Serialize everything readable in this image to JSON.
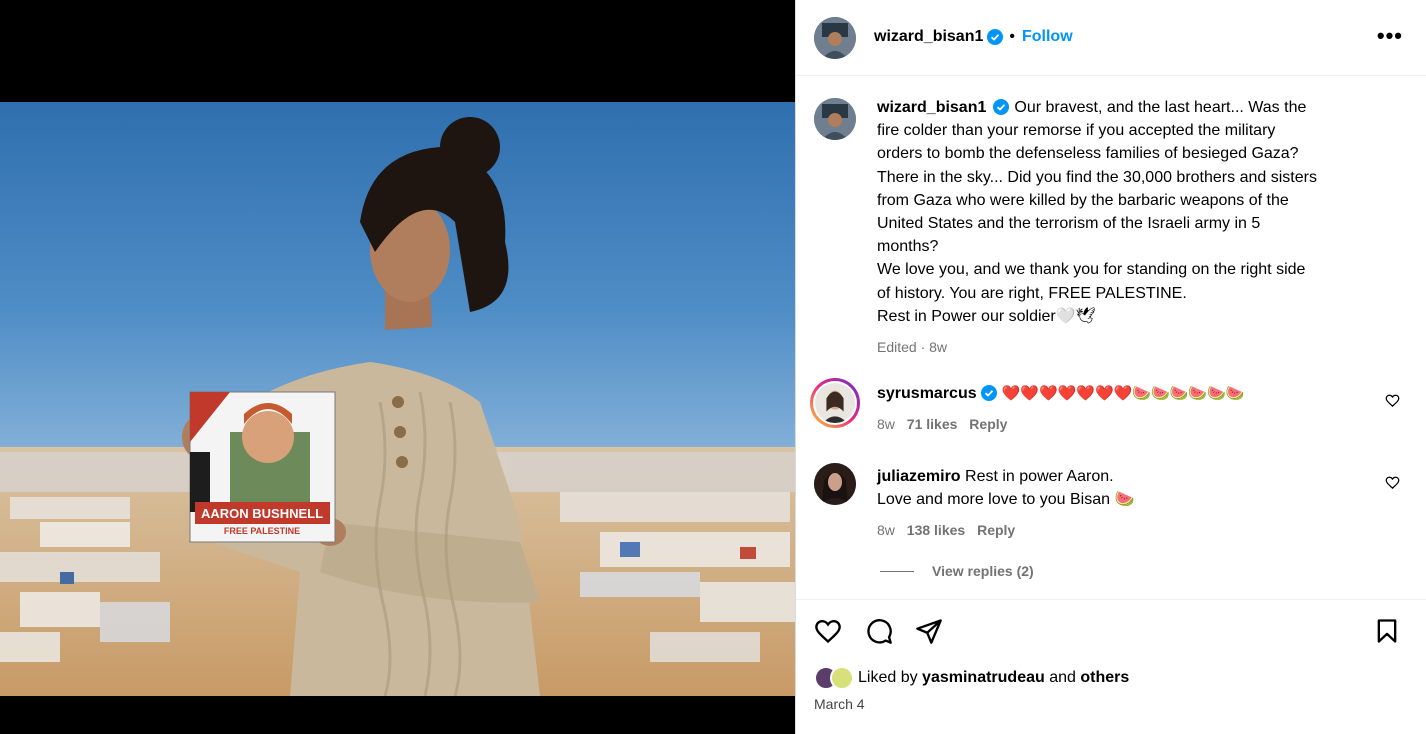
{
  "post": {
    "image": {
      "sign_line1": "AARON BUSHNELL",
      "sign_line2": "FREE PALESTINE"
    }
  },
  "header": {
    "username": "wizard_bisan1",
    "separator": "•",
    "follow_label": "Follow",
    "more_label": "•••"
  },
  "caption": {
    "username": "wizard_bisan1",
    "lines": [
      "Our bravest, and the last heart... Was the",
      "fire colder than your remorse if you accepted the military",
      "orders to bomb the defenseless families of besieged Gaza?",
      "There in the sky... Did you find the 30,000 brothers and sisters",
      "from Gaza who were killed by the barbaric weapons of the",
      "United States and the terrorism of the Israeli army in 5",
      "months?",
      "We love you, and we thank you for standing on the right side",
      "of history. You are right, FREE PALESTINE.",
      "Rest in Power our soldier🤍🕊"
    ],
    "meta": "Edited · 8w"
  },
  "comments": [
    {
      "username": "syrusmarcus",
      "text": "❤️❤️❤️❤️❤️❤️❤️🍉🍉🍉🍉🍉🍉",
      "age": "8w",
      "likes": "71 likes",
      "reply_label": "Reply"
    },
    {
      "username": "juliazemiro",
      "text_line1": "Rest in power Aaron.",
      "text_line2": "Love and more love to you Bisan 🍉",
      "age": "8w",
      "likes": "138 likes",
      "reply_label": "Reply"
    }
  ],
  "view_replies": "View replies (2)",
  "likes": {
    "prefix": "Liked by ",
    "user": "yasminatrudeau",
    "middle": " and ",
    "others": "others"
  },
  "date": "March 4",
  "colors": {
    "link_blue": "#0095f6",
    "verified_blue": "#0095f6",
    "muted_gray": "#737373",
    "heart_red": "#e0245e"
  },
  "icons": [
    "verified-badge-icon",
    "more-options-icon",
    "heart-icon",
    "comment-icon",
    "share-icon",
    "bookmark-icon",
    "small-heart-icon"
  ]
}
